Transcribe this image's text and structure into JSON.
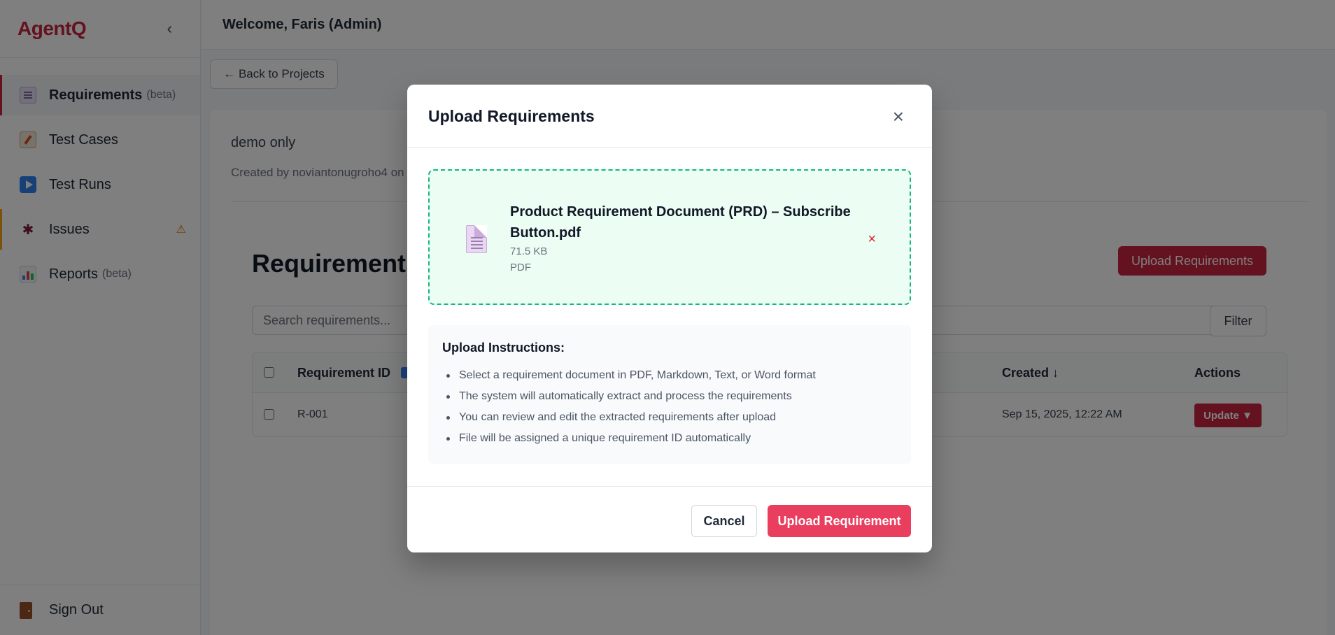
{
  "sidebar": {
    "brand": "AgentQ",
    "collapse_icon": "‹",
    "items": [
      {
        "label": "Requirements",
        "sub": "(beta)"
      },
      {
        "label": "Test Cases",
        "sub": ""
      },
      {
        "label": "Test Runs",
        "sub": ""
      },
      {
        "label": "Issues",
        "sub": "",
        "badge": "⚠"
      },
      {
        "label": "Reports",
        "sub": "(beta)"
      }
    ],
    "signout": "Sign Out"
  },
  "topbar": {
    "welcome": "Welcome, Faris (Admin)"
  },
  "main": {
    "back_label": "← Back to Projects",
    "project_name": "demo only",
    "project_meta": "Created by noviantonugroho4 on",
    "section_title": "Requirements",
    "upload_label": "Upload Requirements",
    "search_placeholder": "Search requirements...",
    "filter_label": "Filter",
    "table": {
      "headers": {
        "id": "Requirement ID",
        "created": "Created ↓",
        "actions": "Actions"
      },
      "rows": [
        {
          "id": "R-001",
          "created": "Sep 15, 2025, 12:22 AM",
          "action": "Update ▼"
        }
      ]
    }
  },
  "modal": {
    "title": "Upload Requirements",
    "close": "×",
    "file": {
      "name": "Product Requirement Document (PRD) – Subscribe Button.pdf",
      "size": "71.5 KB",
      "type": "PDF",
      "remove": "×"
    },
    "instructions": {
      "title": "Upload Instructions:",
      "items": [
        "Select a requirement document in PDF, Markdown, Text, or Word format",
        "The system will automatically extract and process the requirements",
        "You can review and edit the extracted requirements after upload",
        "File will be assigned a unique requirement ID automatically"
      ]
    },
    "cancel_label": "Cancel",
    "submit_label": "Upload Requirement"
  },
  "colors": {
    "brand": "#c8243f",
    "accent": "#e93e5e",
    "success_border": "#10b981",
    "warning": "#f2a516"
  }
}
